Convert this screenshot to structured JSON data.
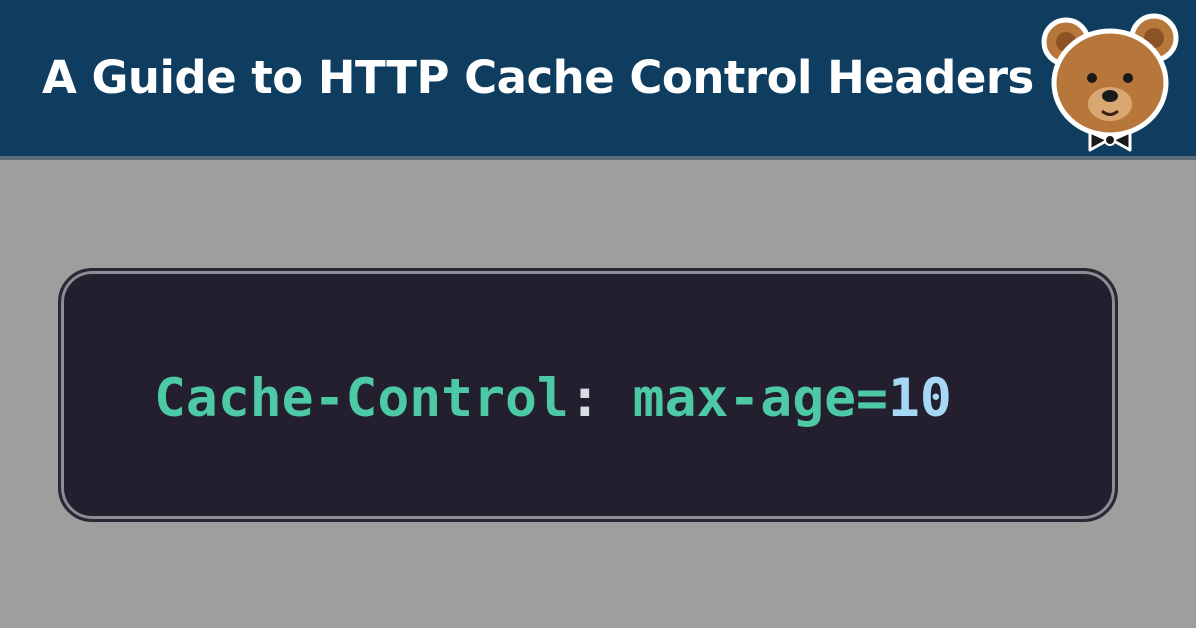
{
  "banner": {
    "title": "A Guide to HTTP Cache Control Headers",
    "background": "#0f3d5f",
    "mascot_icon": "teddy-bear-with-bow-tie-icon"
  },
  "code": {
    "header_name": "Cache-Control",
    "separator": ": ",
    "directive": "max-age=",
    "value": "10",
    "colors": {
      "key": "#4ec9a6",
      "punctuation": "#d8dde3",
      "number": "#a6d8f5",
      "panel": "#231f2e"
    }
  }
}
